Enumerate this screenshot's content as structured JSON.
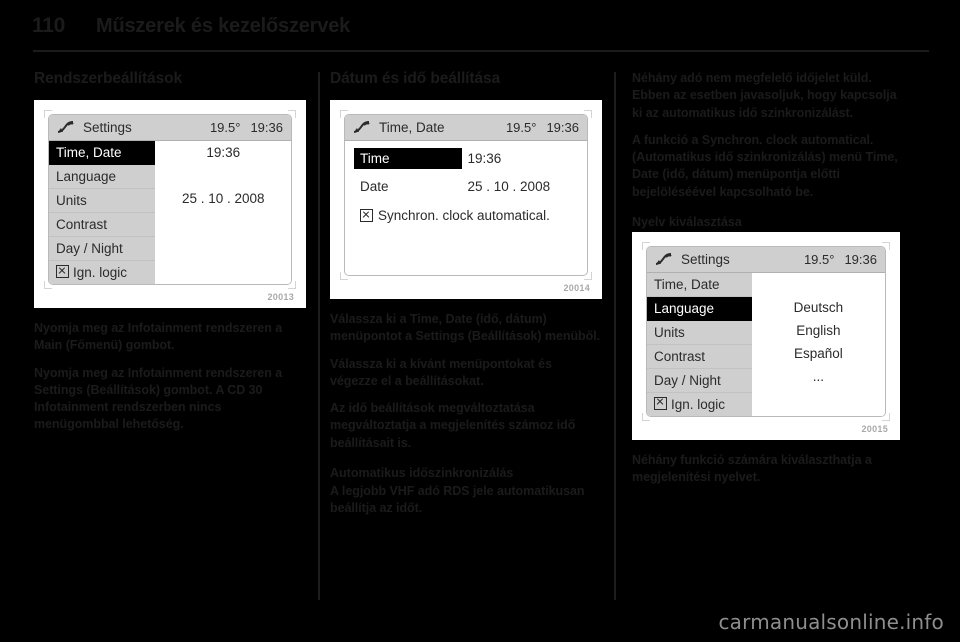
{
  "header": {
    "page_number": "110",
    "title": "Műszerek és kezelőszervek"
  },
  "watermark": "carmanualsonline.info",
  "column1": {
    "heading": "Rendszerbeállítások",
    "figure": {
      "caption": "20013",
      "screen": {
        "icon": "settings-wrench-icon",
        "bar_title": "Settings",
        "temperature": "19.5°",
        "clock": "19:36",
        "menu": [
          {
            "label": "Time, Date",
            "selected": true,
            "checkbox": false
          },
          {
            "label": "Language",
            "selected": false,
            "checkbox": false
          },
          {
            "label": "Units",
            "selected": false,
            "checkbox": false
          },
          {
            "label": "Contrast",
            "selected": false,
            "checkbox": false
          },
          {
            "label": "Day / Night",
            "selected": false,
            "checkbox": false
          },
          {
            "label": "Ign. logic",
            "selected": false,
            "checkbox": true
          }
        ],
        "values": [
          "19:36",
          "",
          "25 . 10 . 2008",
          "",
          "",
          ""
        ]
      }
    },
    "paragraphs": [
      "Nyomja meg az Infotainment rendszeren a Main (Főmenü) gombot.",
      "Nyomja meg az Infotainment rendszeren a Settings (Beállítások) gombot. A CD 30 Infotainment rendszerben nincs menügombbal lehetőség."
    ]
  },
  "column2": {
    "heading": "Dátum és idő beállítása",
    "figure": {
      "caption": "20014",
      "screen": {
        "icon": "settings-wrench-icon",
        "bar_title": "Time, Date",
        "temperature": "19.5°",
        "clock": "19:36",
        "rows": [
          {
            "label": "Time",
            "value": "19:36",
            "selected": true
          },
          {
            "label": "Date",
            "value": "25 . 10 . 2008",
            "selected": false
          }
        ],
        "sync_label": "Synchron. clock automatical.",
        "sync_checked": true
      }
    },
    "paragraphs": [
      "Válassza ki a Time, Date (idő, dátum) menüpontot a Settings (Beállítások) menüből.",
      "Válassza ki a kívánt menüpontokat és végezze el a beállításokat.",
      "Az idő beállítások megváltoztatása megváltoztatja a megjelenítés számoz idő beállításait is."
    ],
    "subheading": "Automatikus időszinkronizálás",
    "tail_paragraph": "A legjobb VHF adó RDS jele automatikusan beállítja az időt."
  },
  "column3": {
    "paragraphs_top": [
      "Néhány adó nem megfelelő időjelet küld. Ebben az esetben javasoljuk, hogy kapcsolja ki az automatikus idő szinkronizálást.",
      "A funkció a Synchron. clock automatical. (Automatikus idő szinkronizálás) menü Time, Date (idő, dátum) menüpontja előtti bejelöléséével kapcsolható be."
    ],
    "subheading": "Nyelv kiválasztása",
    "figure": {
      "caption": "20015",
      "screen": {
        "icon": "settings-wrench-icon",
        "bar_title": "Settings",
        "temperature": "19.5°",
        "clock": "19:36",
        "menu": [
          {
            "label": "Time, Date",
            "selected": false,
            "checkbox": false
          },
          {
            "label": "Language",
            "selected": true,
            "checkbox": false
          },
          {
            "label": "Units",
            "selected": false,
            "checkbox": false
          },
          {
            "label": "Contrast",
            "selected": false,
            "checkbox": false
          },
          {
            "label": "Day / Night",
            "selected": false,
            "checkbox": false
          },
          {
            "label": "Ign. logic",
            "selected": false,
            "checkbox": true
          }
        ],
        "values": [
          "",
          "Deutsch",
          "English",
          "Español",
          "...",
          ""
        ]
      }
    },
    "tail_paragraph": "Néhány funkció számára kiválaszthatja a megjelenítési nyelvet."
  }
}
